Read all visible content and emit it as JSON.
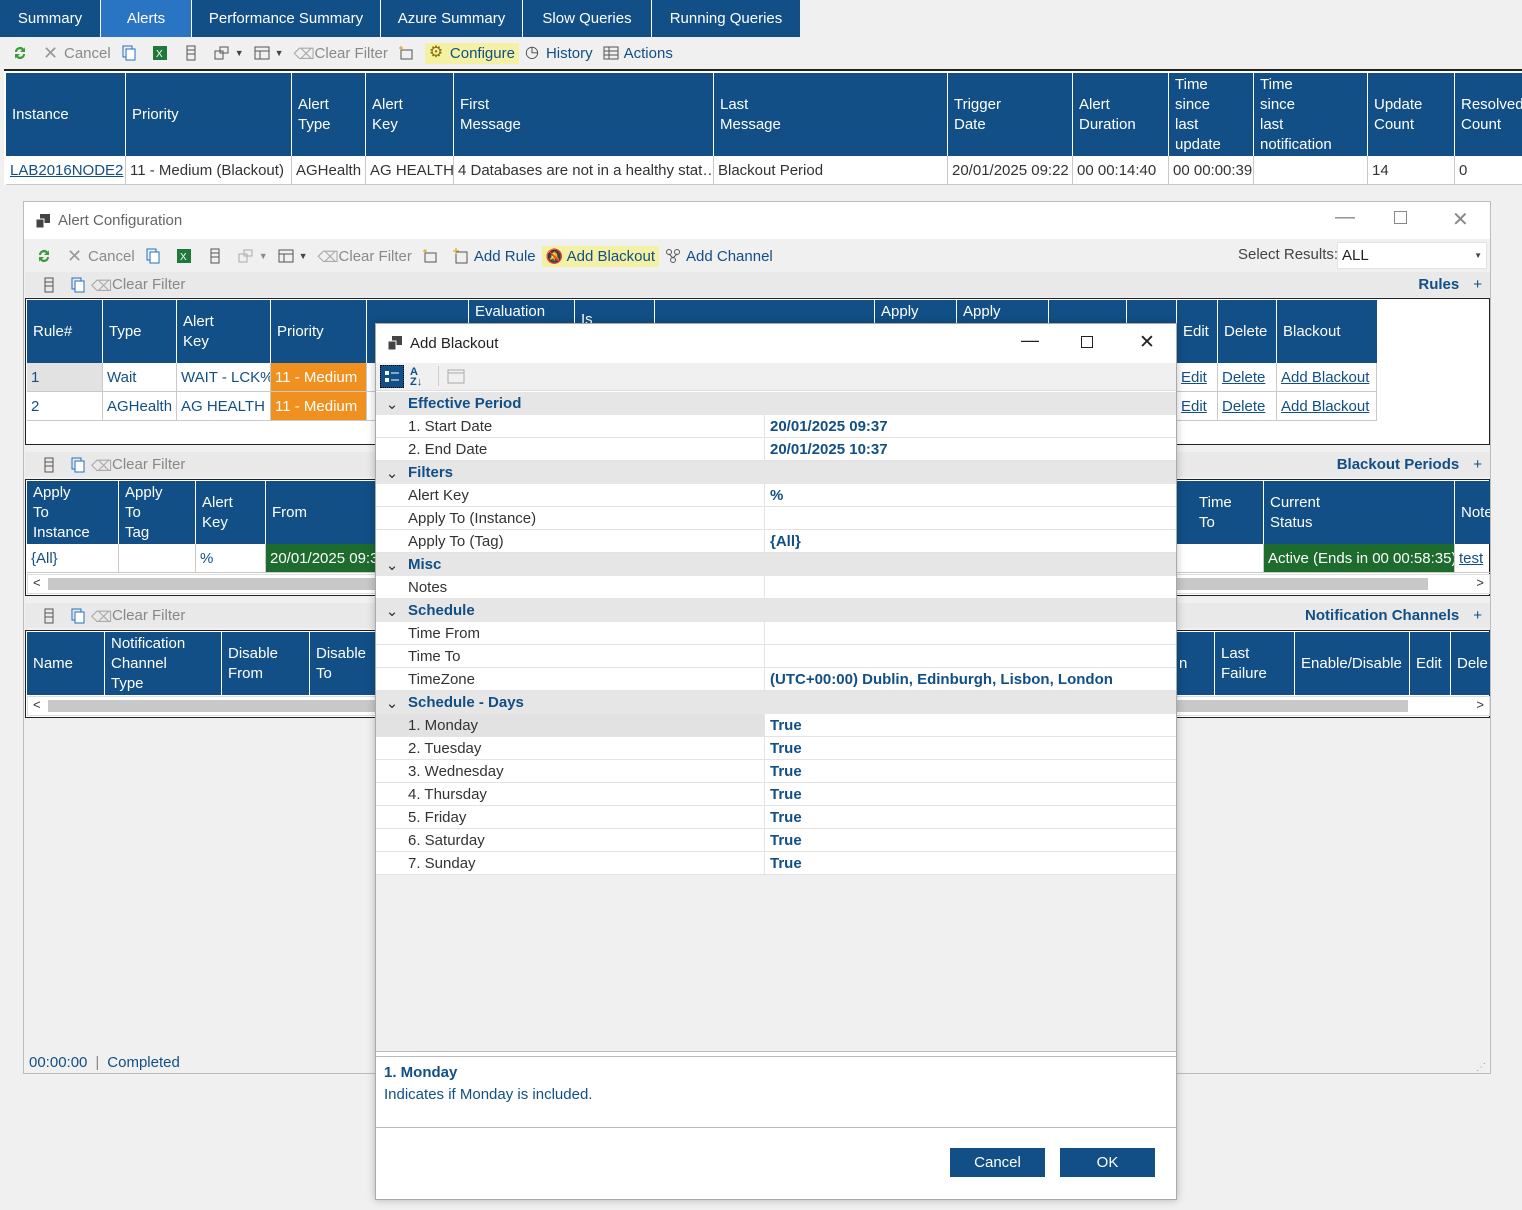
{
  "tabs": [
    "Summary",
    "Alerts",
    "Performance Summary",
    "Azure Summary",
    "Slow Queries",
    "Running Queries"
  ],
  "main_toolbar": {
    "cancel": "Cancel",
    "clear_filter": "Clear Filter",
    "configure": "Configure",
    "history": "History",
    "actions": "Actions"
  },
  "alerts_table": {
    "headers": [
      "Instance",
      "Priority",
      "Alert\nType",
      "Alert\nKey",
      "First\nMessage",
      "Last\nMessage",
      "Trigger\nDate",
      "Alert\nDuration",
      "Time\nsince\nlast\nupdate",
      "Time\nsince\nlast\nnotification",
      "Update\nCount",
      "Resolved\nCount"
    ],
    "row": [
      "LAB2016NODE2",
      "11 - Medium (Blackout)",
      "AGHealth",
      "AG HEALTH",
      "4 Databases are not in a healthy stat…",
      "Blackout Period",
      "20/01/2025 09:22",
      "00 00:14:40",
      "00 00:00:39",
      "",
      "14",
      "0"
    ]
  },
  "alert_config": {
    "title": "Alert Configuration",
    "toolbar": {
      "cancel": "Cancel",
      "clear_filter": "Clear Filter",
      "add_rule": "Add Rule",
      "add_blackout": "Add Blackout",
      "add_channel": "Add Channel",
      "select_results_label": "Select Results:",
      "select_results_value": "ALL"
    },
    "rules_group": {
      "clear_filter": "Clear Filter",
      "title": "Rules",
      "plus": "+"
    },
    "rules_headers_left": [
      "Rule#",
      "Type",
      "Alert\nKey",
      "Priority"
    ],
    "rules_headers_right": [
      "Edit",
      "Delete",
      "Blackout"
    ],
    "rules_partial_headers": [
      "Evaluation",
      "Is",
      "Apply",
      "Apply"
    ],
    "rules_rows": [
      {
        "num": "1",
        "type": "Wait",
        "key": "WAIT - LCK%",
        "priority": "11 - Medium",
        "edit": "Edit",
        "delete": "Delete",
        "blackout": "Add Blackout"
      },
      {
        "num": "2",
        "type": "AGHealth",
        "key": "AG HEALTH",
        "priority": "11 - Medium",
        "edit": "Edit",
        "delete": "Delete",
        "blackout": "Add Blackout"
      }
    ],
    "blackout_group": {
      "clear_filter": "Clear Filter",
      "title": "Blackout Periods",
      "plus": "+"
    },
    "blackout_headers_left": [
      "Apply\nTo\nInstance",
      "Apply\nTo\nTag",
      "Alert\nKey",
      "From"
    ],
    "blackout_headers_right": [
      "Time\nTo",
      "Current\nStatus",
      "Note"
    ],
    "blackout_row": {
      "instance": "{All}",
      "tag": "",
      "key": "%",
      "from": "20/01/2025 09:3",
      "time_to": "",
      "status": "Active (Ends in 00 00:58:35)",
      "note": "test"
    },
    "channels_group": {
      "clear_filter": "Clear Filter",
      "title": "Notification Channels",
      "plus": "+"
    },
    "channels_headers_left": [
      "Name",
      "Notification\nChannel\nType",
      "Disable\nFrom",
      "Disable\nTo"
    ],
    "channels_headers_right": [
      "n",
      "Last\nFailure",
      "Enable/Disable",
      "Edit",
      "Dele"
    ],
    "status": {
      "time": "00:00:00",
      "sep": "|",
      "text": "Completed"
    }
  },
  "add_blackout": {
    "title": "Add Blackout",
    "categories": [
      {
        "name": "Effective Period",
        "rows": [
          [
            "1. Start Date",
            "20/01/2025 09:37"
          ],
          [
            "2. End Date",
            "20/01/2025 10:37"
          ]
        ]
      },
      {
        "name": "Filters",
        "rows": [
          [
            "Alert Key",
            "%"
          ],
          [
            "Apply To (Instance)",
            ""
          ],
          [
            "Apply To (Tag)",
            "{All}"
          ]
        ]
      },
      {
        "name": "Misc",
        "rows": [
          [
            "Notes",
            ""
          ]
        ]
      },
      {
        "name": "Schedule",
        "rows": [
          [
            "Time From",
            ""
          ],
          [
            "Time To",
            ""
          ],
          [
            "TimeZone",
            "(UTC+00:00) Dublin, Edinburgh, Lisbon, London"
          ]
        ]
      },
      {
        "name": "Schedule - Days",
        "rows": [
          [
            "1. Monday",
            "True"
          ],
          [
            "2. Tuesday",
            "True"
          ],
          [
            "3. Wednesday",
            "True"
          ],
          [
            "4. Thursday",
            "True"
          ],
          [
            "5. Friday",
            "True"
          ],
          [
            "6. Saturday",
            "True"
          ],
          [
            "7. Sunday",
            "True"
          ]
        ]
      }
    ],
    "help_title": "1. Monday",
    "help_text": "Indicates if Monday is included.",
    "cancel": "Cancel",
    "ok": "OK"
  },
  "colors": {
    "brand": "#114f86",
    "medium": "#f0901e",
    "active": "#1e6b2e",
    "highlight": "#f4f1a5"
  }
}
